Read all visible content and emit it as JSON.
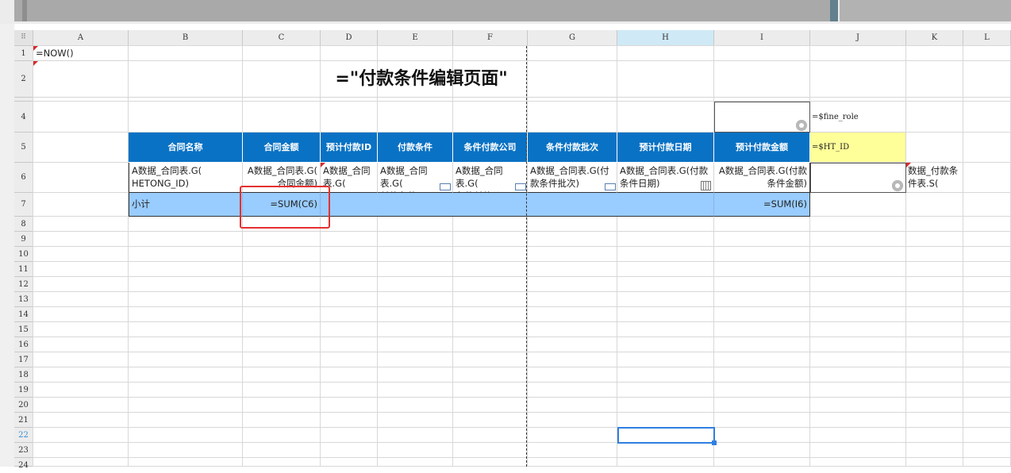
{
  "window": {
    "title": ""
  },
  "columns": [
    "A",
    "B",
    "C",
    "D",
    "E",
    "F",
    "G",
    "H",
    "I",
    "J",
    "K",
    "L"
  ],
  "rows": [
    "1",
    "2",
    "4",
    "5",
    "6",
    "7",
    "8",
    "9",
    "10",
    "11",
    "12",
    "13",
    "14",
    "15",
    "16",
    "17",
    "18",
    "19",
    "20",
    "21",
    "22",
    "23",
    "24"
  ],
  "selected_column": "H",
  "selected_row": "22",
  "cells": {
    "A1": "=NOW()",
    "A2_title": "=\"付款条件编辑页面\"",
    "J4": "=$fine_role",
    "J5": "=$HT_ID",
    "header": [
      "合同名称",
      "合同金额",
      "预计付款ID",
      "付款条件",
      "条件付款公司",
      "条件付款批次",
      "预计付款日期",
      "预计付款金额"
    ],
    "row6": [
      "A数据_合同表.G(\nHETONG_ID)",
      "A数据_合同表.G(\n合同金额)",
      "A数据_合同\n表.G(",
      "A数据_合同表.G(\n付款条件)",
      "A数据_合同表.G(\n条件付款公司)",
      "A数据_合同表.G(付\n款条件批次)",
      "A数据_合同表.G(付款\n条件日期)",
      "A数据_合同表.G(付款\n条件金额)"
    ],
    "K6": "数据_付款条\n件表.S(",
    "B7": "小计",
    "C7": "=SUM(C6)",
    "I7": "=SUM(I6)"
  },
  "colors": {
    "header_bg": "#0a72c4",
    "subtotal_bg": "#99ccff",
    "param_bg": "#ffff99",
    "highlight_border": "#e53030",
    "selection_border": "#2f7fe0"
  }
}
